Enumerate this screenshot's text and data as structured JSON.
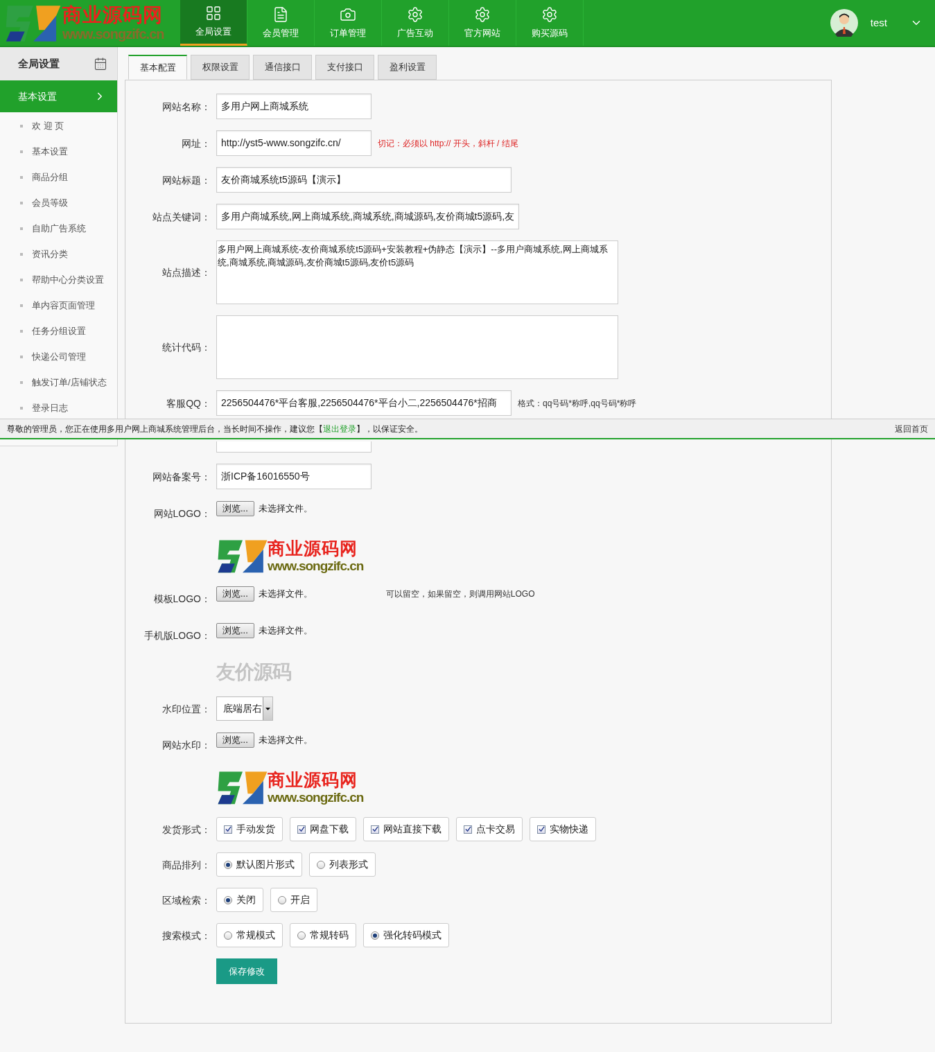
{
  "header": {
    "logo": {
      "title": "商业源码网",
      "url": "www.songzifc.cn"
    },
    "nav": [
      {
        "label": "全局设置",
        "selected": true
      },
      {
        "label": "会员管理",
        "selected": false
      },
      {
        "label": "订单管理",
        "selected": false
      },
      {
        "label": "广告互动",
        "selected": false
      },
      {
        "label": "官方网站",
        "selected": false
      },
      {
        "label": "购买源码",
        "selected": false
      }
    ],
    "user": {
      "name": "test"
    }
  },
  "sidebar": {
    "title": "全局设置",
    "section": {
      "label": "基本设置",
      "selected": true
    },
    "items": [
      "欢 迎 页",
      "基本设置",
      "商品分组",
      "会员等级",
      "自助广告系统",
      "资讯分类",
      "帮助中心分类设置",
      "单内容页面管理",
      "任务分组设置",
      "快递公司管理",
      "触发订单/店铺状态",
      "登录日志"
    ]
  },
  "tabs": [
    {
      "label": "基本配置",
      "selected": true
    },
    {
      "label": "权限设置",
      "selected": false
    },
    {
      "label": "通信接口",
      "selected": false
    },
    {
      "label": "支付接口",
      "selected": false
    },
    {
      "label": "盈利设置",
      "selected": false
    }
  ],
  "form": {
    "fields": [
      {
        "kind": "text",
        "label": "网站名称：",
        "value": "多用户网上商城系统"
      },
      {
        "kind": "text",
        "label": "网址：",
        "value": "http://yst5-www.songzifc.cn/",
        "warning": "切记：必须以 http:// 开头，斜杆 / 结尾"
      },
      {
        "kind": "text_wide",
        "label": "网站标题：",
        "value": "友价商城系统t5源码【演示】"
      },
      {
        "kind": "text_wide",
        "label": "站点关键词：",
        "value": "多用户商城系统,网上商城系统,商城系统,商城源码,友价商城t5源码,友"
      },
      {
        "kind": "textarea",
        "label": "站点描述：",
        "value": "多用户网上商城系统-友价商城系统t5源码+安装教程+伪静态【演示】--多用户商城系统,网上商城系统,商城系统,商城源码,友价商城t5源码,友价t5源码"
      },
      {
        "kind": "textarea",
        "label": "统计代码："
      },
      {
        "kind": "text_wide",
        "label": "客服QQ：",
        "value": "2256504476*平台客服,2256504476*平台小二,2256504476*招商",
        "hint": "格式：qq号码*称呼,qq号码*称呼"
      },
      {
        "kind": "covered"
      },
      {
        "kind": "text",
        "label": "网站备案号：",
        "value": "浙ICP备16016550号"
      },
      {
        "kind": "file",
        "label": "网站LOGO：",
        "button": "浏览...",
        "status": "未选择文件。"
      },
      {
        "kind": "logo",
        "title": "商业源码网",
        "url": "www.songzifc.cn"
      },
      {
        "kind": "file",
        "label": "模板LOGO：",
        "button": "浏览...",
        "status": "未选择文件。",
        "hint": "可以留空，如果留空，则调用网站LOGO"
      },
      {
        "kind": "file",
        "label": "手机版LOGO：",
        "button": "浏览...",
        "status": "未选择文件。"
      },
      {
        "kind": "mobile_logo",
        "title": "友价源码"
      },
      {
        "kind": "select",
        "label": "水印位置：",
        "value": "底端居右"
      },
      {
        "kind": "file",
        "label": "网站水印：",
        "button": "浏览...",
        "status": "未选择文件。"
      },
      {
        "kind": "logo",
        "title": "商业源码网",
        "url": "www.songzifc.cn"
      },
      {
        "kind": "checks",
        "label": "发货形式：",
        "options": [
          {
            "label": "手动发货",
            "checked": true
          },
          {
            "label": "网盘下载",
            "checked": true
          },
          {
            "label": "网站直接下载",
            "checked": true
          },
          {
            "label": "点卡交易",
            "checked": true
          },
          {
            "label": "实物快递",
            "checked": true
          }
        ]
      },
      {
        "kind": "radios",
        "label": "商品排列：",
        "options": [
          {
            "label": "默认图片形式",
            "selected": true
          },
          {
            "label": "列表形式",
            "selected": false
          }
        ]
      },
      {
        "kind": "radios",
        "label": "区域检索：",
        "options": [
          {
            "label": "关闭",
            "selected": true
          },
          {
            "label": "开启",
            "selected": false
          }
        ]
      },
      {
        "kind": "radios",
        "label": "搜索模式：",
        "options": [
          {
            "label": "常规模式",
            "selected": false
          },
          {
            "label": "常规转码",
            "selected": false
          },
          {
            "label": "强化转码模式",
            "selected": true
          }
        ]
      }
    ],
    "save_button": "保存修改"
  },
  "notice": {
    "before": "尊敬的管理员，您正在使用多用户网上商城系统管理后台，当长时间不操作，建议您【",
    "link": "退出登录",
    "after": "】，以保证安全。",
    "home_link": "返回首页"
  }
}
